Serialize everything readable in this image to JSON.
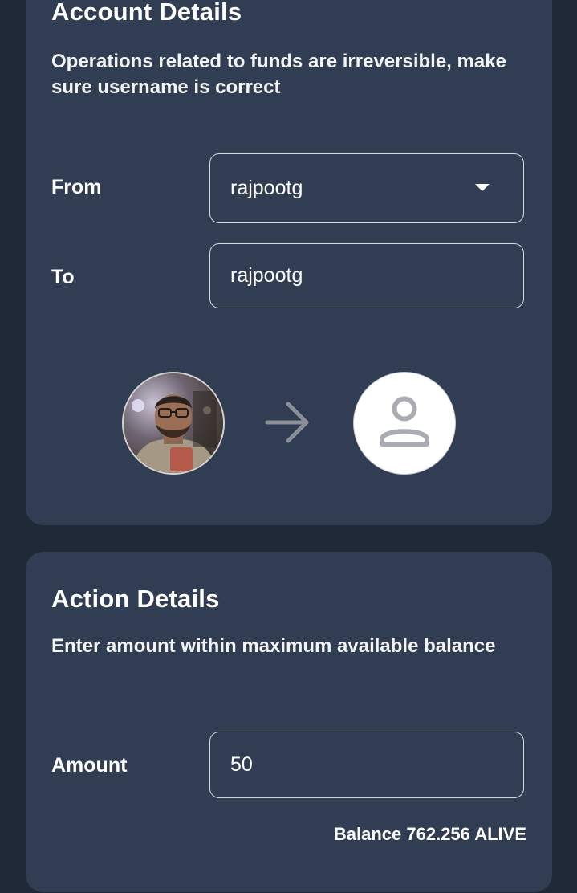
{
  "account": {
    "title": "Account Details",
    "description": "Operations related to funds are irreversible, make sure username is correct",
    "from_label": "From",
    "from_value": "rajpootg",
    "to_label": "To",
    "to_value": "rajpootg",
    "sender_avatar": "user-photo",
    "arrow_icon": "arrow-right-icon",
    "recipient_avatar": "person-placeholder-icon"
  },
  "action": {
    "title": "Action Details",
    "description": "Enter amount within maximum available balance",
    "amount_label": "Amount",
    "amount_value": "50",
    "balance_text": "Balance 762.256 ALIVE"
  },
  "colors": {
    "background": "#1f2937",
    "card": "#313d52",
    "border": "#d4d8de",
    "arrow": "#8a8f98"
  }
}
